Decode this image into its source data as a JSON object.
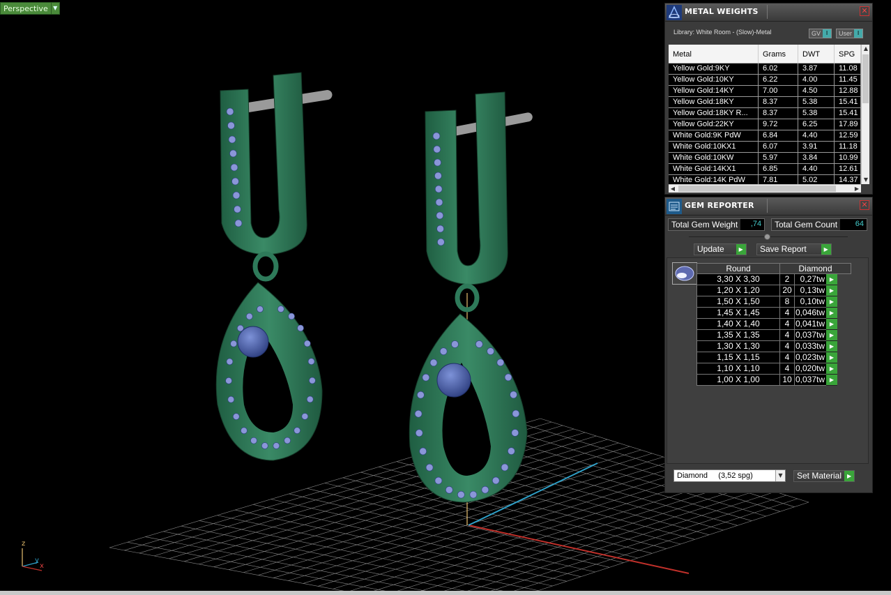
{
  "viewport": {
    "view_mode": "Perspective",
    "axis_labels": {
      "z": "z",
      "y": "y",
      "x": "x"
    }
  },
  "metal_weights": {
    "title": "METAL WEIGHTS",
    "library": "Library: White Room - (Slow)-Metal",
    "toggle_gv": "GV",
    "toggle_user": "User",
    "columns": [
      "Metal",
      "Grams",
      "DWT",
      "SPG"
    ],
    "rows": [
      {
        "metal": "Yellow Gold:9KY",
        "grams": "6.02",
        "dwt": "3.87",
        "spg": "11.08"
      },
      {
        "metal": "Yellow Gold:10KY",
        "grams": "6.22",
        "dwt": "4.00",
        "spg": "11.45"
      },
      {
        "metal": "Yellow Gold:14KY",
        "grams": "7.00",
        "dwt": "4.50",
        "spg": "12.88"
      },
      {
        "metal": "Yellow Gold:18KY",
        "grams": "8.37",
        "dwt": "5.38",
        "spg": "15.41"
      },
      {
        "metal": "Yellow Gold:18KY R...",
        "grams": "8.37",
        "dwt": "5.38",
        "spg": "15.41"
      },
      {
        "metal": "Yellow Gold:22KY",
        "grams": "9.72",
        "dwt": "6.25",
        "spg": "17.89"
      },
      {
        "metal": "White Gold:9K PdW",
        "grams": "6.84",
        "dwt": "4.40",
        "spg": "12.59"
      },
      {
        "metal": "White Gold:10KX1",
        "grams": "6.07",
        "dwt": "3.91",
        "spg": "11.18"
      },
      {
        "metal": "White Gold:10KW",
        "grams": "5.97",
        "dwt": "3.84",
        "spg": "10.99"
      },
      {
        "metal": "White Gold:14KX1",
        "grams": "6.85",
        "dwt": "4.40",
        "spg": "12.61"
      },
      {
        "metal": "White Gold:14K PdW",
        "grams": "7.81",
        "dwt": "5.02",
        "spg": "14.37"
      }
    ]
  },
  "gem_reporter": {
    "title": "GEM REPORTER",
    "total_weight_label": "Total Gem Weight",
    "total_weight_value": ",74",
    "total_count_label": "Total Gem Count",
    "total_count_value": "64",
    "update_label": "Update",
    "save_report_label": "Save Report",
    "table_headers": {
      "shape": "Round",
      "material": "Diamond"
    },
    "gems": [
      {
        "size": "3,30 X 3,30",
        "count": "2",
        "weight": "0,27tw"
      },
      {
        "size": "1,20 X 1,20",
        "count": "20",
        "weight": "0,13tw"
      },
      {
        "size": "1,50 X 1,50",
        "count": "8",
        "weight": "0,10tw"
      },
      {
        "size": "1,45 X 1,45",
        "count": "4",
        "weight": "0,046tw"
      },
      {
        "size": "1,40 X 1,40",
        "count": "4",
        "weight": "0,041tw"
      },
      {
        "size": "1,35 X 1,35",
        "count": "4",
        "weight": "0,037tw"
      },
      {
        "size": "1,30 X 1,30",
        "count": "4",
        "weight": "0,033tw"
      },
      {
        "size": "1,15 X 1,15",
        "count": "4",
        "weight": "0,023tw"
      },
      {
        "size": "1,10 X 1,10",
        "count": "4",
        "weight": "0,020tw"
      },
      {
        "size": "1,00 X 1,00",
        "count": "10",
        "weight": "0,037tw"
      }
    ],
    "material_select": "Diamond     (3,52 spg)",
    "set_material_label": "Set Material"
  },
  "colors": {
    "metal_green": "#2e7a5a",
    "gem_blue": "#4a5fa8",
    "grid": "#8a8a8a",
    "x_axis": "#c0302a",
    "y_axis": "#2fa0c8",
    "z_axis": "#e8c070",
    "button_green": "#3aa53a"
  }
}
